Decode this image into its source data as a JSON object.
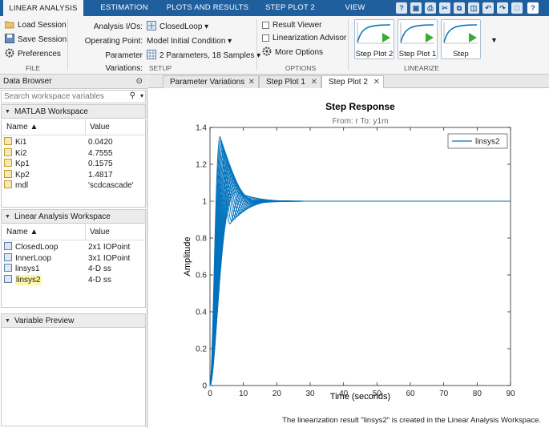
{
  "tabs": [
    {
      "label": "LINEAR ANALYSIS",
      "active": true
    },
    {
      "label": "ESTIMATION",
      "active": false
    },
    {
      "label": "PLOTS AND RESULTS",
      "active": false
    },
    {
      "label": "STEP PLOT 2",
      "active": false
    },
    {
      "label": "VIEW",
      "active": false
    }
  ],
  "ribbon": {
    "file": {
      "label": "FILE",
      "load": "Load Session",
      "save": "Save Session",
      "prefs": "Preferences"
    },
    "setup": {
      "label": "SETUP",
      "io_label": "Analysis I/Os:",
      "io_value": "ClosedLoop",
      "op_label": "Operating Point:",
      "op_value": "Model Initial Condition",
      "pv_label": "Parameter Variations:",
      "pv_value": "2 Parameters, 18 Samples"
    },
    "options": {
      "label": "OPTIONS",
      "result_viewer": "Result Viewer",
      "lin_advisor": "Linearization Advisor",
      "more_options": "More Options"
    },
    "linearize": {
      "label": "LINEARIZE",
      "thumbs": [
        "Step Plot 2",
        "Step Plot 1",
        "Step"
      ]
    }
  },
  "browser": {
    "title": "Data Browser",
    "search_placeholder": "Search workspace variables",
    "matlab_ws": {
      "title": "MATLAB Workspace",
      "col_name": "Name ▲",
      "col_value": "Value",
      "rows": [
        {
          "name": "Ki1",
          "value": "0.0420"
        },
        {
          "name": "Ki2",
          "value": "4.7555"
        },
        {
          "name": "Kp1",
          "value": "0.1575"
        },
        {
          "name": "Kp2",
          "value": "1.4817"
        },
        {
          "name": "mdl",
          "value": "'scdcascade'"
        }
      ]
    },
    "lin_ws": {
      "title": "Linear Analysis Workspace",
      "col_name": "Name ▲",
      "col_value": "Value",
      "rows": [
        {
          "name": "ClosedLoop",
          "value": "2x1 IOPoint"
        },
        {
          "name": "InnerLoop",
          "value": "3x1 IOPoint"
        },
        {
          "name": "linsys1",
          "value": "4-D ss"
        },
        {
          "name": "linsys2",
          "value": "4-D ss"
        }
      ]
    },
    "var_preview": {
      "title": "Variable Preview"
    }
  },
  "doc_tabs": [
    {
      "label": "Parameter Variations",
      "active": false
    },
    {
      "label": "Step Plot 1",
      "active": false
    },
    {
      "label": "Step Plot 2",
      "active": true
    }
  ],
  "status": "The linearization result \"linsys2\" is created in the Linear Analysis Workspace.",
  "colors": {
    "accent": "#1f5f9e",
    "series": "#0072bd",
    "highlight": "#fff7a8"
  },
  "chart_data": {
    "type": "line",
    "title": "Step Response",
    "subtitle": "From: r  To: y1m",
    "xlabel": "Time (seconds)",
    "ylabel": "Amplitude",
    "xlim": [
      0,
      90
    ],
    "ylim": [
      0,
      1.4
    ],
    "xticks": [
      0,
      10,
      20,
      30,
      40,
      50,
      60,
      70,
      80,
      90
    ],
    "yticks": [
      0,
      0.2,
      0.4,
      0.6,
      0.8,
      1,
      1.2,
      1.4
    ],
    "legend": {
      "position": "top-right",
      "entries": [
        "linsys2"
      ]
    },
    "series": [
      {
        "name": "linsys2",
        "samples": 18,
        "peak_range": [
          1.05,
          1.35
        ],
        "peak_time_range": [
          3,
          8
        ],
        "settle_time": 40,
        "final_value": 1.0
      }
    ]
  }
}
